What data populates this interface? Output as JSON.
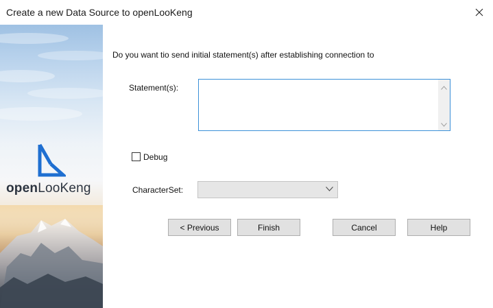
{
  "window": {
    "title": "Create a new Data Source to openLooKeng"
  },
  "banner": {
    "logo_open": "open",
    "logo_rest": "LooKeng"
  },
  "content": {
    "question": "Do you want tio send initial statement(s) after establishing connection to",
    "statements_label": "Statement(s):",
    "statements_value": "",
    "debug_label": "Debug",
    "debug_checked": false,
    "charset_label": "CharacterSet:",
    "charset_value": ""
  },
  "buttons": {
    "previous": "< Previous",
    "finish": "Finish",
    "cancel": "Cancel",
    "help": "Help"
  },
  "colors": {
    "focus_border": "#3a8fd8",
    "button_bg": "#e1e1e1",
    "logo_blue": "#1f6fd1"
  },
  "icons": {
    "close": "close-icon",
    "logo": "openlookeng-logo-icon",
    "scroll_up": "scroll-up-arrow-icon",
    "scroll_down": "scroll-down-arrow-icon",
    "dropdown": "chevron-down-icon"
  }
}
